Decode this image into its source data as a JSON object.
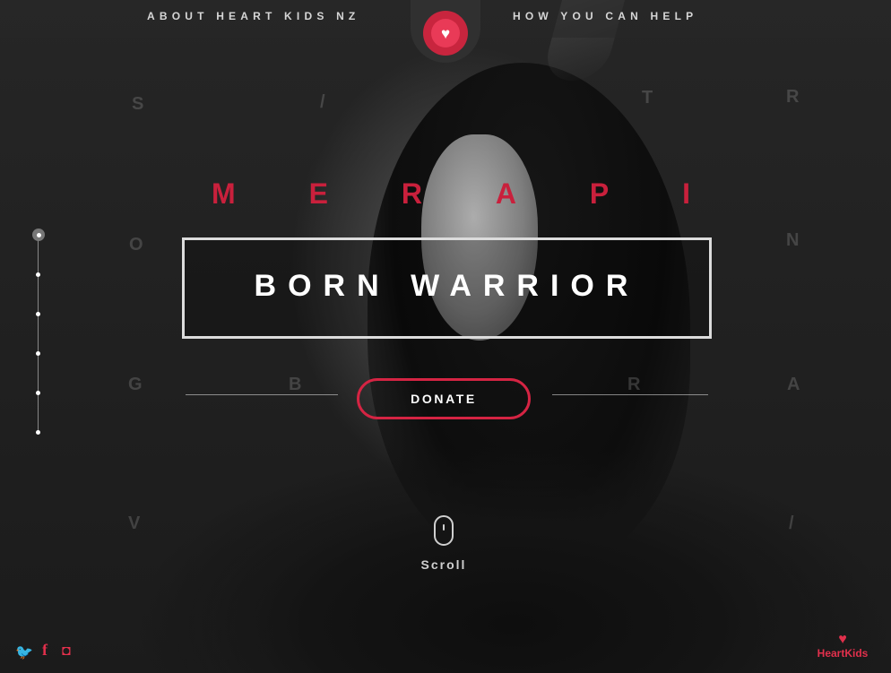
{
  "nav": {
    "left_label": "ABOUT HEART KIDS NZ",
    "right_label": "HOW YOU CAN HELP",
    "logo_glyph": "♥"
  },
  "hero": {
    "name_letters": [
      "M",
      "E",
      "R",
      "A",
      "P",
      "I"
    ],
    "title": "BORN WARRIOR",
    "donate_label": "DONATE",
    "scroll_label": "Scroll"
  },
  "background_letters": [
    "S",
    "/",
    "T",
    "R",
    "O",
    "N",
    "G",
    "B",
    "R",
    "A",
    "V",
    "/"
  ],
  "slide_nav": {
    "count": 6,
    "active_index": 0
  },
  "social": {
    "twitter": "🐦",
    "facebook": "f",
    "instagram": "◘"
  },
  "brand": {
    "heart": "♥",
    "name": "HeartKids"
  },
  "colors": {
    "accent": "#d52443",
    "background": "#1e1e1e",
    "text": "#ffffff"
  }
}
